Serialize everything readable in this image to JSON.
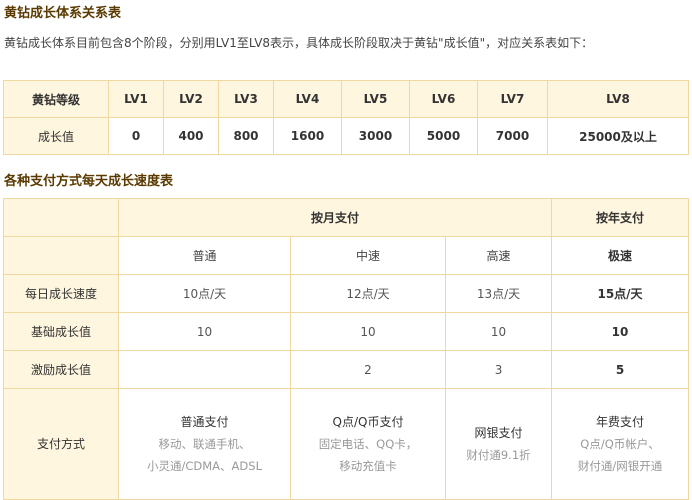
{
  "title1": "黄钻成长体系关系表",
  "intro": "黄钻成长体系目前包含8个阶段，分别用LV1至LV8表示，具体成长阶段取决于黄钻\"成长值\"，对应关系表如下：",
  "level_table": {
    "header_label": "黄钻等级",
    "levels": [
      "LV1",
      "LV2",
      "LV3",
      "LV4",
      "LV5",
      "LV6",
      "LV7",
      "LV8"
    ],
    "value_label": "成长值",
    "values": [
      "0",
      "400",
      "800",
      "1600",
      "3000",
      "5000",
      "7000",
      "25000及以上"
    ]
  },
  "title2": "各种支付方式每天成长速度表",
  "speed_table": {
    "monthly_header": "按月支付",
    "yearly_header": "按年支付",
    "sub_headers": [
      "普通",
      "中速",
      "高速",
      "极速"
    ],
    "rows": [
      {
        "label": "每日成长速度",
        "cells": [
          "10点/天",
          "12点/天",
          "13点/天",
          "15点/天"
        ]
      },
      {
        "label": "基础成长值",
        "cells": [
          "10",
          "10",
          "10",
          "10"
        ]
      },
      {
        "label": "激励成长值",
        "cells": [
          "",
          "2",
          "3",
          "5"
        ]
      }
    ],
    "pay_label": "支付方式",
    "pay": [
      {
        "main": "普通支付",
        "lines": [
          "移动、联通手机、",
          "小灵通/CDMA、ADSL"
        ]
      },
      {
        "main": "Q点/Q币支付",
        "lines": [
          "固定电话、QQ卡，",
          "移动充值卡"
        ]
      },
      {
        "main": "网银支付",
        "lines": [
          "财付通9.1折"
        ]
      },
      {
        "main": "年费支付",
        "lines": [
          "Q点/Q币帐户、",
          "财付通/网银开通"
        ]
      }
    ]
  },
  "colors": {
    "header_bg": "#fff6df",
    "border": "#f0d8a0",
    "title": "#5a3a00"
  }
}
